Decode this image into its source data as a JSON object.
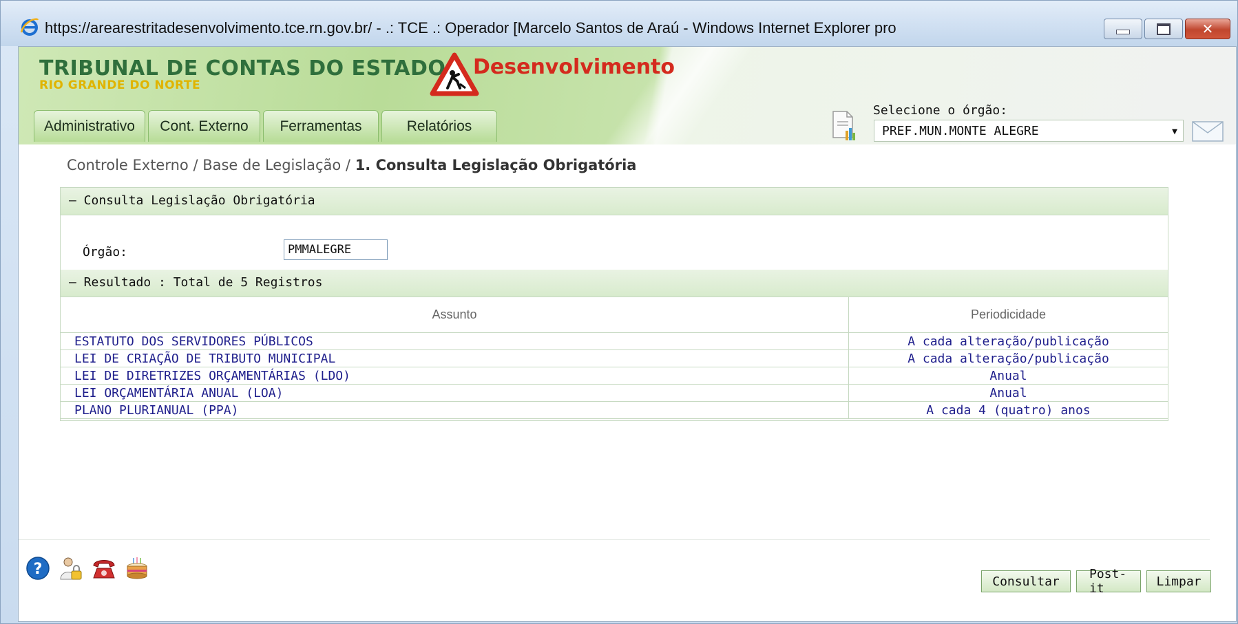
{
  "window": {
    "title": "https://arearestritadesenvolvimento.tce.rn.gov.br/ - .: TCE .: Operador [Marcelo Santos de Araú - Windows Internet Explorer pro"
  },
  "header": {
    "logo_main": "TRIBUNAL DE CONTAS DO ESTADO",
    "logo_sub": "RIO GRANDE DO NORTE",
    "environment": "Desenvolvimento",
    "tabs": [
      {
        "label": "Administrativo"
      },
      {
        "label": "Cont. Externo"
      },
      {
        "label": "Ferramentas"
      },
      {
        "label": "Relatórios"
      }
    ],
    "orgao_label": "Selecione o órgão:",
    "orgao_selected": "PREF.MUN.MONTE ALEGRE"
  },
  "breadcrumb": {
    "part1": "Controle Externo / Base de Legislação / ",
    "current": "1. Consulta Legislação Obrigatória"
  },
  "panel": {
    "title": "–  Consulta Legislação Obrigatória",
    "orgao_label": "Órgão:",
    "orgao_value": "PMMALEGRE",
    "result_title": "–  Resultado : Total de 5 Registros",
    "columns": [
      "Assunto",
      "Periodicidade"
    ],
    "rows": [
      {
        "assunto": "ESTATUTO DOS SERVIDORES PÚBLICOS",
        "periodicidade": "A cada alteração/publicação"
      },
      {
        "assunto": "LEI DE CRIAÇÃO DE TRIBUTO MUNICIPAL",
        "periodicidade": "A cada alteração/publicação"
      },
      {
        "assunto": "LEI DE DIRETRIZES ORÇAMENTÁRIAS (LDO)",
        "periodicidade": "Anual"
      },
      {
        "assunto": "LEI ORÇAMENTÁRIA ANUAL (LOA)",
        "periodicidade": "Anual"
      },
      {
        "assunto": "PLANO PLURIANUAL (PPA)",
        "periodicidade": "A cada 4 (quatro) anos"
      }
    ]
  },
  "footer": {
    "icons": [
      "help-icon",
      "user-lock-icon",
      "telephone-icon",
      "birthday-cake-icon"
    ],
    "buttons": {
      "consultar": "Consultar",
      "postit": "Post-it",
      "limpar": "Limpar"
    }
  },
  "colors": {
    "header_green": "#b9dc98",
    "logo_green": "#2f6f3c",
    "logo_yellow": "#e0b400",
    "dev_red": "#d42a1d",
    "link_blue": "#1f1f8c"
  }
}
